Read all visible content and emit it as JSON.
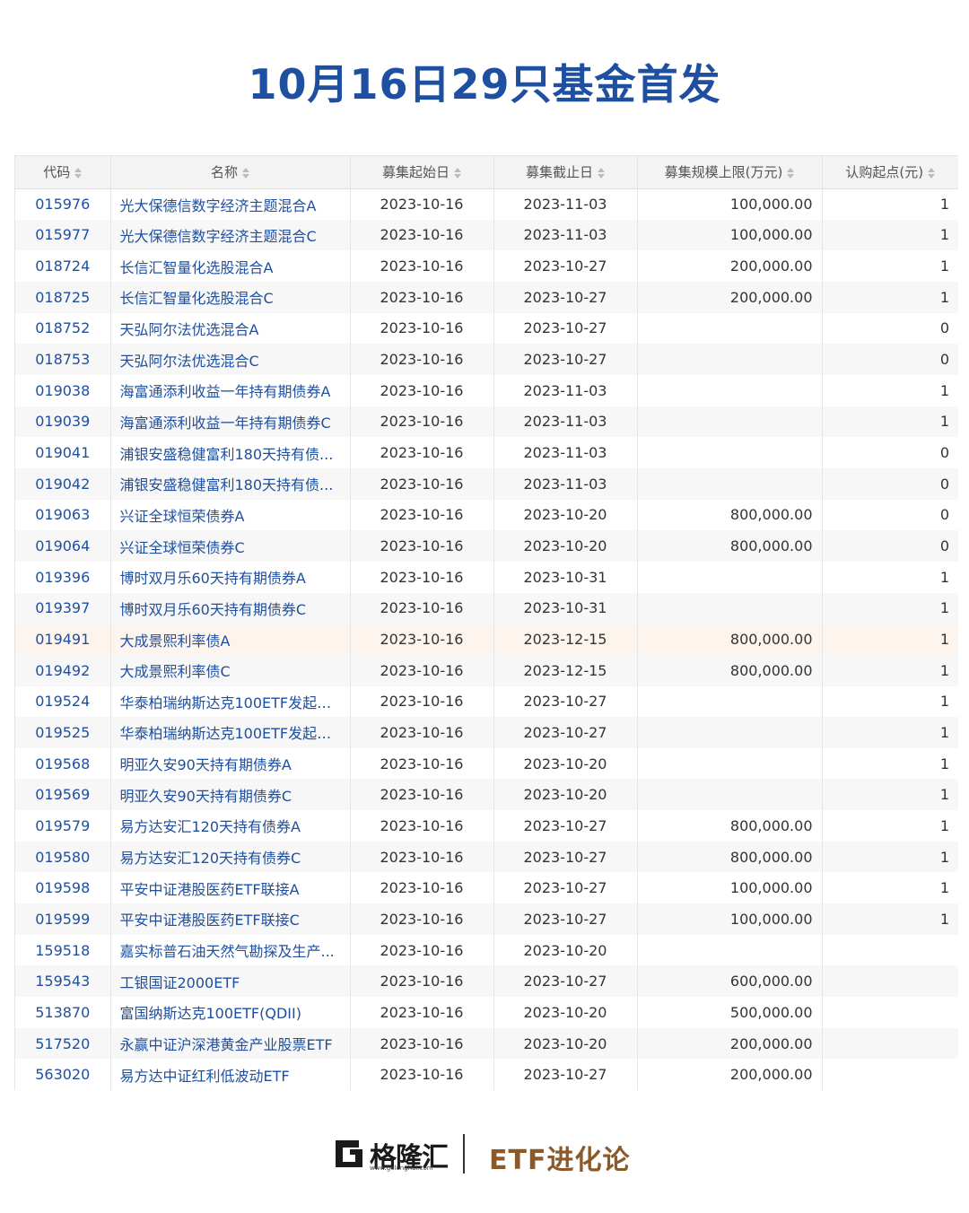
{
  "title": "10月16日29只基金首发",
  "table": {
    "headers": [
      "代码",
      "名称",
      "募集起始日",
      "募集截止日",
      "募集规模上限(万元)",
      "认购起点(元)"
    ],
    "rows": [
      {
        "code": "015976",
        "name": "光大保德信数字经济主题混合A",
        "start": "2023-10-16",
        "end": "2023-11-03",
        "cap": "100,000.00",
        "min": "1"
      },
      {
        "code": "015977",
        "name": "光大保德信数字经济主题混合C",
        "start": "2023-10-16",
        "end": "2023-11-03",
        "cap": "100,000.00",
        "min": "1"
      },
      {
        "code": "018724",
        "name": "长信汇智量化选股混合A",
        "start": "2023-10-16",
        "end": "2023-10-27",
        "cap": "200,000.00",
        "min": "1"
      },
      {
        "code": "018725",
        "name": "长信汇智量化选股混合C",
        "start": "2023-10-16",
        "end": "2023-10-27",
        "cap": "200,000.00",
        "min": "1"
      },
      {
        "code": "018752",
        "name": "天弘阿尔法优选混合A",
        "start": "2023-10-16",
        "end": "2023-10-27",
        "cap": "",
        "min": "0"
      },
      {
        "code": "018753",
        "name": "天弘阿尔法优选混合C",
        "start": "2023-10-16",
        "end": "2023-10-27",
        "cap": "",
        "min": "0"
      },
      {
        "code": "019038",
        "name": "海富通添利收益一年持有期债券A",
        "start": "2023-10-16",
        "end": "2023-11-03",
        "cap": "",
        "min": "1"
      },
      {
        "code": "019039",
        "name": "海富通添利收益一年持有期债券C",
        "start": "2023-10-16",
        "end": "2023-11-03",
        "cap": "",
        "min": "1"
      },
      {
        "code": "019041",
        "name": "浦银安盛稳健富利180天持有债...",
        "start": "2023-10-16",
        "end": "2023-11-03",
        "cap": "",
        "min": "0"
      },
      {
        "code": "019042",
        "name": "浦银安盛稳健富利180天持有债...",
        "start": "2023-10-16",
        "end": "2023-11-03",
        "cap": "",
        "min": "0"
      },
      {
        "code": "019063",
        "name": "兴证全球恒荣债券A",
        "start": "2023-10-16",
        "end": "2023-10-20",
        "cap": "800,000.00",
        "min": "0"
      },
      {
        "code": "019064",
        "name": "兴证全球恒荣债券C",
        "start": "2023-10-16",
        "end": "2023-10-20",
        "cap": "800,000.00",
        "min": "0"
      },
      {
        "code": "019396",
        "name": "博时双月乐60天持有期债券A",
        "start": "2023-10-16",
        "end": "2023-10-31",
        "cap": "",
        "min": "1"
      },
      {
        "code": "019397",
        "name": "博时双月乐60天持有期债券C",
        "start": "2023-10-16",
        "end": "2023-10-31",
        "cap": "",
        "min": "1"
      },
      {
        "code": "019491",
        "name": "大成景熙利率债A",
        "start": "2023-10-16",
        "end": "2023-12-15",
        "cap": "800,000.00",
        "min": "1"
      },
      {
        "code": "019492",
        "name": "大成景熙利率债C",
        "start": "2023-10-16",
        "end": "2023-12-15",
        "cap": "800,000.00",
        "min": "1"
      },
      {
        "code": "019524",
        "name": "华泰柏瑞纳斯达克100ETF发起式...",
        "start": "2023-10-16",
        "end": "2023-10-27",
        "cap": "",
        "min": "1"
      },
      {
        "code": "019525",
        "name": "华泰柏瑞纳斯达克100ETF发起式...",
        "start": "2023-10-16",
        "end": "2023-10-27",
        "cap": "",
        "min": "1"
      },
      {
        "code": "019568",
        "name": "明亚久安90天持有期债券A",
        "start": "2023-10-16",
        "end": "2023-10-20",
        "cap": "",
        "min": "1"
      },
      {
        "code": "019569",
        "name": "明亚久安90天持有期债券C",
        "start": "2023-10-16",
        "end": "2023-10-20",
        "cap": "",
        "min": "1"
      },
      {
        "code": "019579",
        "name": "易方达安汇120天持有债券A",
        "start": "2023-10-16",
        "end": "2023-10-27",
        "cap": "800,000.00",
        "min": "1"
      },
      {
        "code": "019580",
        "name": "易方达安汇120天持有债券C",
        "start": "2023-10-16",
        "end": "2023-10-27",
        "cap": "800,000.00",
        "min": "1"
      },
      {
        "code": "019598",
        "name": "平安中证港股医药ETF联接A",
        "start": "2023-10-16",
        "end": "2023-10-27",
        "cap": "100,000.00",
        "min": "1"
      },
      {
        "code": "019599",
        "name": "平安中证港股医药ETF联接C",
        "start": "2023-10-16",
        "end": "2023-10-27",
        "cap": "100,000.00",
        "min": "1"
      },
      {
        "code": "159518",
        "name": "嘉实标普石油天然气勘探及生产...",
        "start": "2023-10-16",
        "end": "2023-10-20",
        "cap": "",
        "min": ""
      },
      {
        "code": "159543",
        "name": "工银国证2000ETF",
        "start": "2023-10-16",
        "end": "2023-10-27",
        "cap": "600,000.00",
        "min": ""
      },
      {
        "code": "513870",
        "name": "富国纳斯达克100ETF(QDII)",
        "start": "2023-10-16",
        "end": "2023-10-20",
        "cap": "500,000.00",
        "min": ""
      },
      {
        "code": "517520",
        "name": "永赢中证沪深港黄金产业股票ETF",
        "start": "2023-10-16",
        "end": "2023-10-20",
        "cap": "200,000.00",
        "min": ""
      },
      {
        "code": "563020",
        "name": "易方达中证红利低波动ETF",
        "start": "2023-10-16",
        "end": "2023-10-27",
        "cap": "200,000.00",
        "min": ""
      }
    ],
    "highlight_row": 14
  },
  "footer": {
    "logo_text": "格隆汇",
    "logo_url": "www.gelonghui.com",
    "brand": "ETF进化论",
    "logo_icon": "gelonghui-logo-icon"
  },
  "colors": {
    "title": "#1e4fa0",
    "link": "#1e4fa0",
    "brand": "#8a5a2b",
    "highlight_row": "#fdf4ee"
  }
}
